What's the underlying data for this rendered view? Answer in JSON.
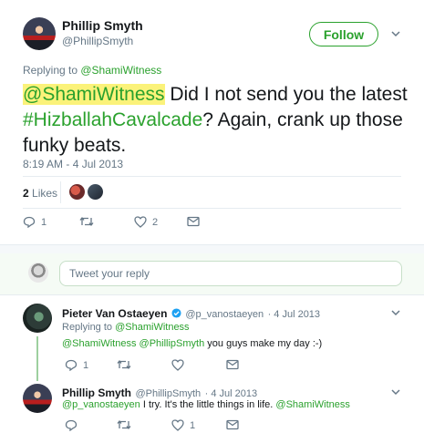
{
  "main_tweet": {
    "author_name": "Phillip Smyth",
    "author_handle": "@PhillipSmyth",
    "follow_label": "Follow",
    "replying_prefix": "Replying to ",
    "replying_handle": "@ShamiWitness",
    "text_mention": "@ShamiWitness",
    "text_part1": " Did I not send you the latest",
    "text_hashtag": "#HizballahCavalcade",
    "text_part2": "? Again, crank up those",
    "text_part3": "funky beats.",
    "timestamp": "8:19 AM - 4 Jul 2013",
    "likes_count": "2",
    "likes_label": " Likes",
    "actions": {
      "reply_count": "1",
      "retweet_count": "",
      "like_count": "2"
    }
  },
  "compose": {
    "placeholder": "Tweet your reply"
  },
  "replies": [
    {
      "author_name": "Pieter Van Ostaeyen",
      "author_handle": "@p_vanostaeyen",
      "date": "· 4 Jul 2013",
      "replying_prefix": "Replying to ",
      "replying_handle": "@ShamiWitness",
      "mention1": "@ShamiWitness",
      "mention2": "@PhillipSmyth",
      "text": " you guys make my day :-)",
      "reply_count": "1",
      "like_count": ""
    },
    {
      "author_name": "Phillip Smyth",
      "author_handle": "@PhillipSmyth",
      "date": "· 4 Jul 2013",
      "mention1": "@p_vanostaeyen",
      "text": " I try. It's the little things in life. ",
      "mention2": "@ShamiWitness",
      "reply_count": "",
      "like_count": "1"
    }
  ],
  "colors": {
    "accent": "#2aa12d",
    "highlight": "#fbf27a",
    "muted": "#657786",
    "verified": "#1da1f2"
  }
}
